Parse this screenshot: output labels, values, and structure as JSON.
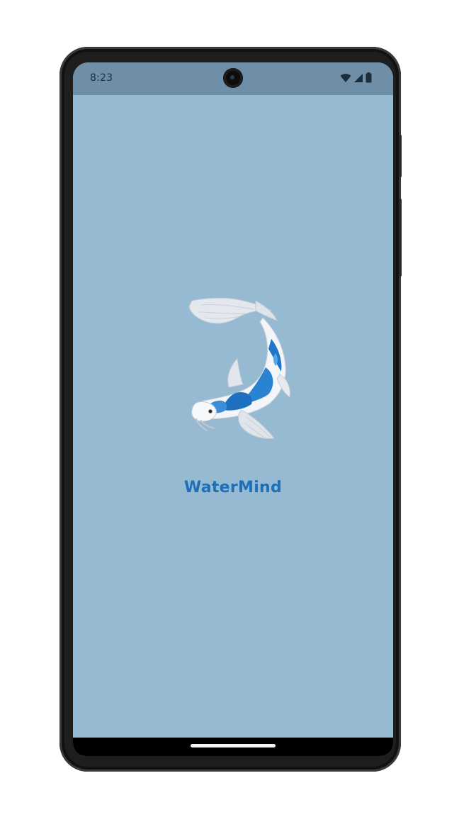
{
  "status_bar": {
    "time": "8:23",
    "icons": [
      "wifi-icon",
      "signal-icon",
      "battery-icon"
    ]
  },
  "splash": {
    "app_name": "WaterMind",
    "logo": "koi-fish-logo"
  },
  "colors": {
    "screen_background": "#97bad3",
    "status_bar": "#6f8fa8",
    "app_name": "#1f6fb6",
    "koi_blue": "#1f75c9"
  }
}
